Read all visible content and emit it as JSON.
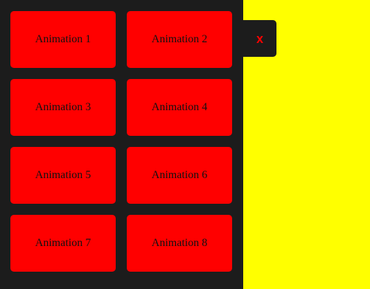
{
  "colors": {
    "panel_background": "#1c1c1c",
    "page_background": "#ffff00",
    "button_background": "#ff0000",
    "close_icon": "#ff0000"
  },
  "panel": {
    "buttons": [
      {
        "label": "Animation 1"
      },
      {
        "label": "Animation 2"
      },
      {
        "label": "Animation 3"
      },
      {
        "label": "Animation 4"
      },
      {
        "label": "Animation 5"
      },
      {
        "label": "Animation 6"
      },
      {
        "label": "Animation 7"
      },
      {
        "label": "Animation 8"
      }
    ]
  },
  "close": {
    "label": "x",
    "icon": "close-icon"
  }
}
